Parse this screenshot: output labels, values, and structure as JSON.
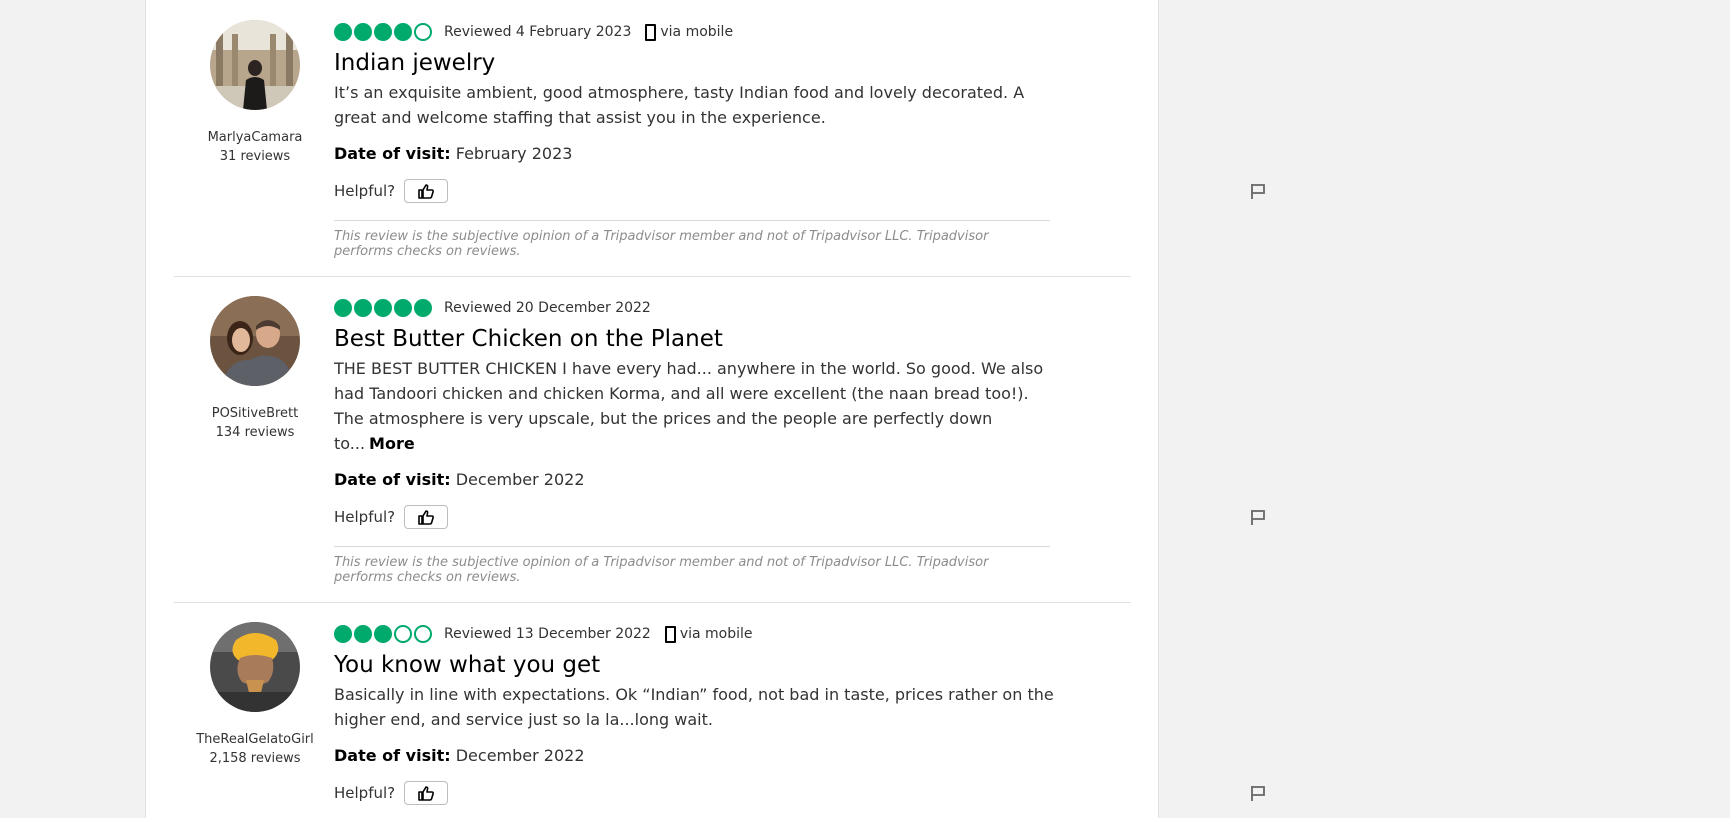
{
  "colors": {
    "bubble": "#00aa6c",
    "page_background": "#f2f2f2",
    "disclaimer_text": "#8c8c8c"
  },
  "reviews": [
    {
      "user": {
        "name": "MarlyaCamara",
        "reviews": "31 reviews"
      },
      "rating": 4,
      "reviewed": "Reviewed 4 February 2023",
      "via_mobile": "via mobile",
      "title": "Indian jewelry",
      "body": "It’s an exquisite ambient, good atmosphere, tasty Indian food and lovely decorated. A great and welcome staffing that assist you in the experience.",
      "more": "",
      "date_label": "Date of visit:",
      "date_value": "February 2023",
      "helpful": "Helpful?",
      "disclaimer": "This review is the subjective opinion of a Tripadvisor member and not of Tripadvisor LLC. Tripadvisor performs checks on reviews."
    },
    {
      "user": {
        "name": "POSitiveBrett",
        "reviews": "134 reviews"
      },
      "rating": 5,
      "reviewed": "Reviewed 20 December 2022",
      "via_mobile": "",
      "title": "Best Butter Chicken on the Planet",
      "body": "THE BEST BUTTER CHICKEN I have every had... anywhere in the world. So good. We also had Tandoori chicken and chicken Korma, and all were excellent (the naan bread too!). The atmosphere is very upscale, but the prices and the people are perfectly down to...",
      "more": "More",
      "date_label": "Date of visit:",
      "date_value": "December 2022",
      "helpful": "Helpful?",
      "disclaimer": "This review is the subjective opinion of a Tripadvisor member and not of Tripadvisor LLC. Tripadvisor performs checks on reviews."
    },
    {
      "user": {
        "name": "TheRealGelatoGirl",
        "reviews": "2,158 reviews"
      },
      "rating": 3,
      "reviewed": "Reviewed 13 December 2022",
      "via_mobile": "via mobile",
      "title": "You know what you get",
      "body": "Basically in line with expectations. Ok “Indian” food, not bad in taste, prices rather on the higher end, and service just so la la...long wait.",
      "more": "",
      "date_label": "Date of visit:",
      "date_value": "December 2022",
      "helpful": "Helpful?"
    }
  ]
}
